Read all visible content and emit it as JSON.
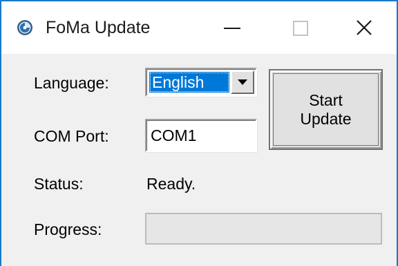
{
  "window": {
    "title": "FoMa Update",
    "icon": "foma-app-icon",
    "controls": {
      "minimize": "minimize-icon",
      "maximize": "maximize-icon",
      "close": "close-icon"
    },
    "accent_color": "#1979ca"
  },
  "form": {
    "language_label": "Language:",
    "language_value": "English",
    "com_port_label": "COM Port:",
    "com_port_value": "COM1",
    "status_label": "Status:",
    "status_value": "Ready.",
    "progress_label": "Progress:",
    "progress_fraction": 0
  },
  "actions": {
    "start_line1": "Start",
    "start_line2": "Update"
  },
  "colors": {
    "selection": "#0078d7",
    "dialog_bg": "#f0f0f0"
  }
}
